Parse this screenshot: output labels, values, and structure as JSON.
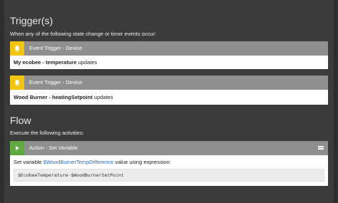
{
  "triggers": {
    "title": "Trigger(s)",
    "subtitle": "When any of the following state change or timer events occur:",
    "items": [
      {
        "header": "Event Trigger - Device",
        "icon": "bell-icon",
        "device": "My ecobee",
        "separator": " - ",
        "attribute": "temperature",
        "suffix": " updates"
      },
      {
        "header": "Event Trigger - Device",
        "icon": "bell-icon",
        "device": "Wood Burner",
        "separator": " - ",
        "attribute": "heatingSetpoint",
        "suffix": " updates"
      }
    ]
  },
  "flow": {
    "title": "Flow",
    "subtitle": "Execute the following activities:",
    "action": {
      "header": "Action - Set Variable",
      "icon": "play-icon",
      "text_prefix": "Set variable ",
      "variable": "$WoodBurnerTempDifference",
      "text_suffix": " value using expression:",
      "expression": "$EcobeeTemperature-$WoodBurnerSetPoint"
    }
  },
  "colors": {
    "background": "#3b3b3b",
    "header_gray": "#8f8f8f",
    "trigger_icon": "#f2c311",
    "action_icon": "#5fa940",
    "link": "#2f6fd6"
  }
}
